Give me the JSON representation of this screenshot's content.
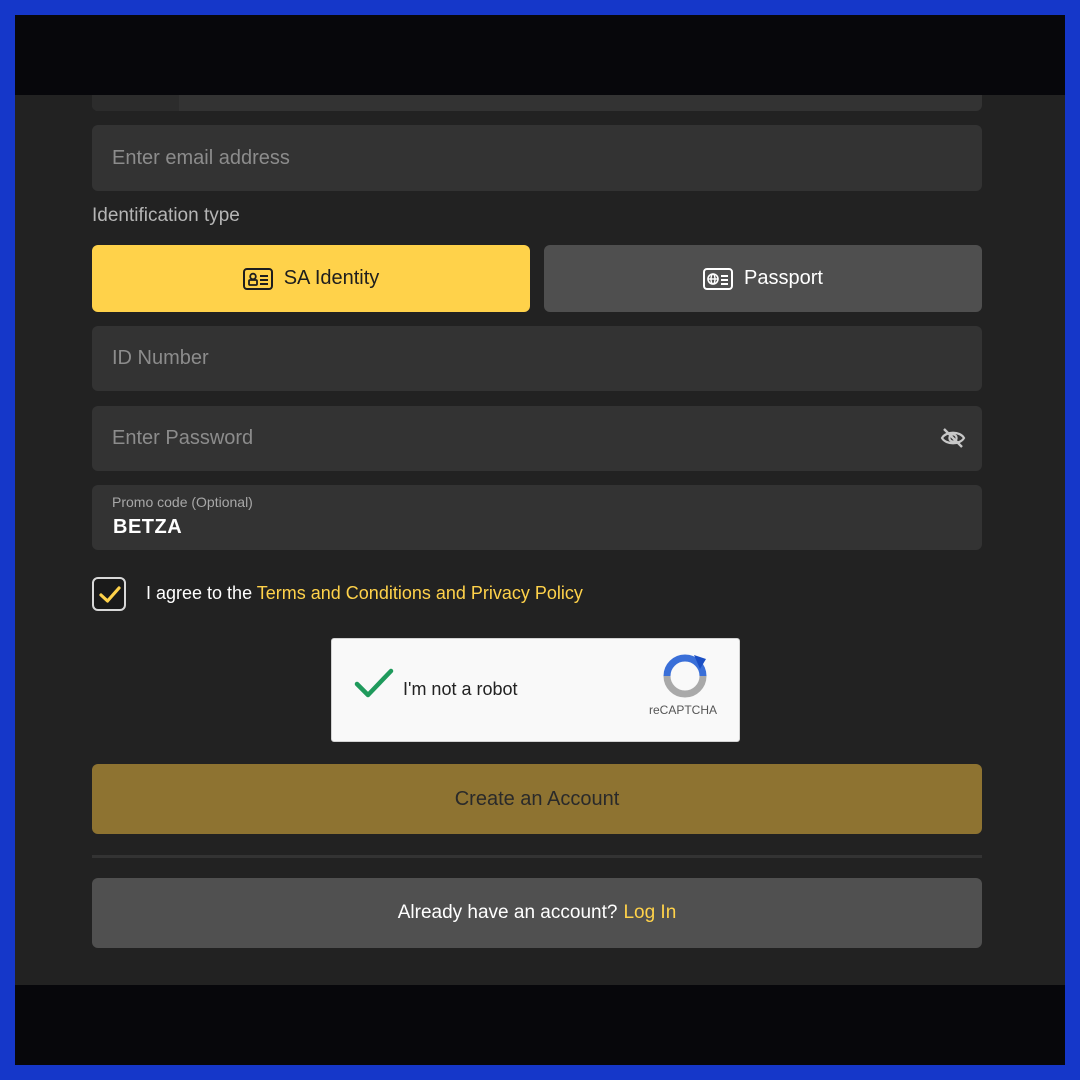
{
  "form": {
    "email": {
      "placeholder": "Enter email address"
    },
    "identification": {
      "label": "Identification type",
      "options": [
        {
          "label": "SA Identity",
          "icon": "id-card-icon",
          "selected": true
        },
        {
          "label": "Passport",
          "icon": "passport-icon",
          "selected": false
        }
      ]
    },
    "id_number": {
      "placeholder": "ID Number"
    },
    "password": {
      "placeholder": "Enter Password",
      "toggle_icon": "eye-slash-icon"
    },
    "promo": {
      "label": "Promo code (Optional)",
      "value": "BETZA"
    },
    "agree": {
      "checked": true,
      "text": "I agree to the ",
      "link": "Terms and Conditions and Privacy Policy"
    },
    "captcha": {
      "checked": true,
      "label": "I'm not a robot",
      "brand": "reCAPTCHA"
    },
    "submit_label": "Create an Account",
    "login_prompt": {
      "text": "Already have an account?",
      "link": "Log In"
    }
  },
  "colors": {
    "accent": "#ffd24a",
    "background": "#222222",
    "field": "#333333",
    "submit": "#8e7331",
    "frame": "#1537c9"
  }
}
